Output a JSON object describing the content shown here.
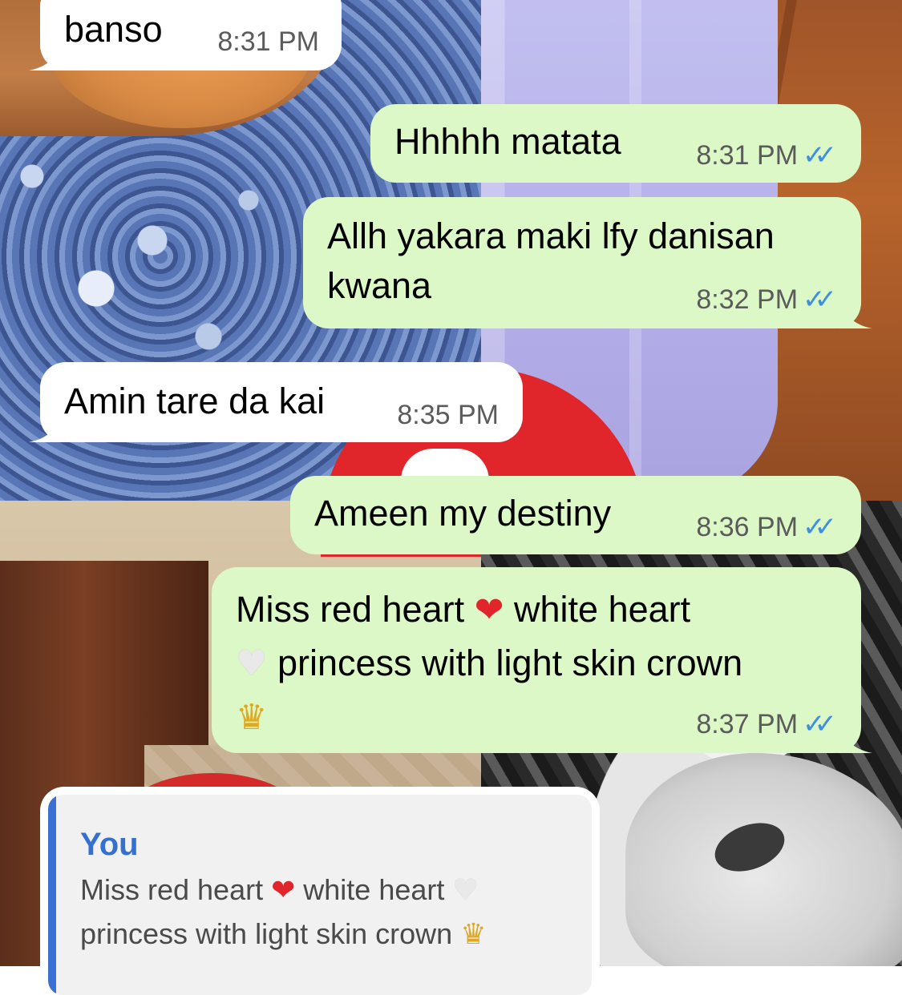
{
  "messages": [
    {
      "direction": "incoming",
      "text": "banso",
      "time": "8:31 PM"
    },
    {
      "direction": "outgoing",
      "text": "Hhhhh matata",
      "time": "8:31 PM",
      "read": true
    },
    {
      "direction": "outgoing",
      "line1": "Allh yakara maki lfy danisan",
      "line2": "kwana",
      "time": "8:32 PM",
      "read": true
    },
    {
      "direction": "incoming",
      "text": "Amin tare da kai",
      "time": "8:35 PM"
    },
    {
      "direction": "outgoing",
      "text": "Ameen my destiny",
      "time": "8:36 PM",
      "read": true
    },
    {
      "direction": "outgoing",
      "part1": "Miss red heart",
      "part2": "white heart",
      "part3": "princess with light skin crown",
      "time": "8:37 PM",
      "read": true
    }
  ],
  "reply": {
    "author": "You",
    "part1": "Miss red heart",
    "part2": "white heart",
    "part3": "princess with light skin crown"
  },
  "icons": {
    "read_receipt": "double-check-icon",
    "emoji_red_heart": "❤",
    "emoji_white_heart": "♥",
    "emoji_crown": "♛"
  },
  "colors": {
    "incoming_bubble": "#ffffff",
    "outgoing_bubble": "#dcf8c6",
    "read_tick": "#3e8ee6",
    "quote_bar": "#3a6fd3"
  }
}
